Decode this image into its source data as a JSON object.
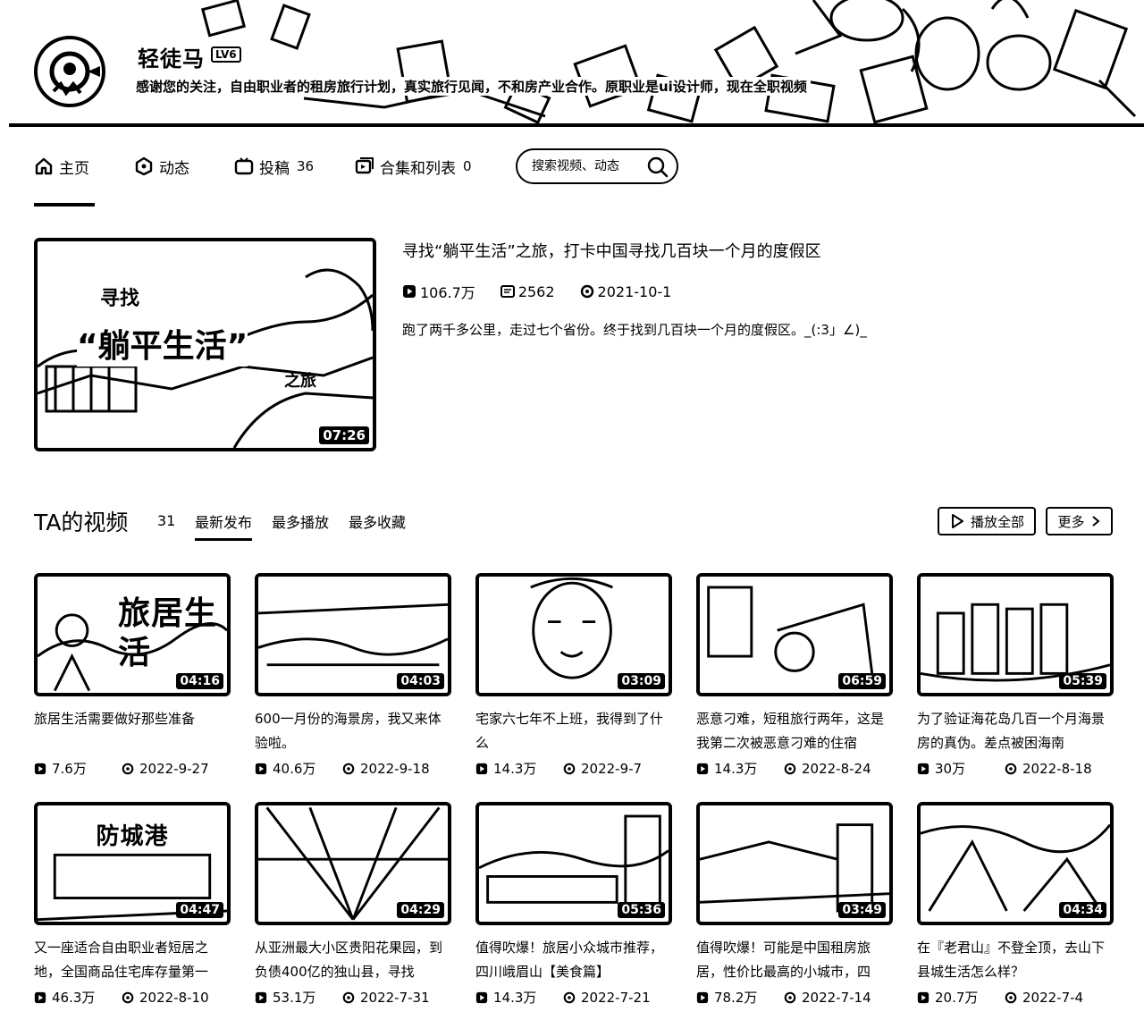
{
  "header": {
    "username": "轻徒马",
    "level": "LV6",
    "sign": "感谢您的关注，自由职业者的租房旅行计划，真实旅行见闻，不和房产业合作。原职业是ui设计师，现在全职视频"
  },
  "nav": {
    "home": "主页",
    "dynamic": "动态",
    "uploads": "投稿",
    "uploads_count": "36",
    "collections": "合集和列表",
    "collections_count": "0",
    "search_placeholder": "搜索视频、动态"
  },
  "featured": {
    "title": "寻找“躺平生活”之旅，打卡中国寻找几百块一个月的度假区",
    "views": "106.7万",
    "danmaku": "2562",
    "date": "2021-10-1",
    "description": "跑了两千多公里，走过七个省份。终于找到几百块一个月的度假区。_(:3」∠)_",
    "duration": "07:26",
    "thumb_text_1": "寻找",
    "thumb_text_2": "“躺平生活”",
    "thumb_text_3": "之旅"
  },
  "videos_section": {
    "title": "TA的视频",
    "count": "31",
    "tabs": [
      "最新发布",
      "最多播放",
      "最多收藏"
    ],
    "play_all": "播放全部",
    "more": "更多"
  },
  "videos": [
    {
      "title": "旅居生活需要做好那些准备",
      "views": "7.6万",
      "date": "2022-9-27",
      "duration": "04:16",
      "thumb_text": "旅居生活"
    },
    {
      "title": "600一月份的海景房，我又来体验啦。",
      "views": "40.6万",
      "date": "2022-9-18",
      "duration": "04:03",
      "thumb_text": ""
    },
    {
      "title": "宅家六七年不上班，我得到了什么",
      "views": "14.3万",
      "date": "2022-9-7",
      "duration": "03:09",
      "thumb_text": ""
    },
    {
      "title": "恶意刁难，短租旅行两年，这是我第二次被恶意刁难的住宿",
      "views": "14.3万",
      "date": "2022-8-24",
      "duration": "06:59",
      "thumb_text": ""
    },
    {
      "title": "为了验证海花岛几百一个月海景房的真伪。差点被困海南",
      "views": "30万",
      "date": "2022-8-18",
      "duration": "05:39",
      "thumb_text": ""
    },
    {
      "title": "又一座适合自由职业者短居之地，全国商品住宅库存量第一",
      "views": "46.3万",
      "date": "2022-8-10",
      "duration": "04:47",
      "thumb_text": "防城港"
    },
    {
      "title": "从亚洲最大小区贵阳花果园，到负债400亿的独山县，寻找",
      "views": "53.1万",
      "date": "2022-7-31",
      "duration": "04:29",
      "thumb_text": ""
    },
    {
      "title": "值得吹爆！旅居小众城市推荐，四川峨眉山【美食篇】",
      "views": "14.3万",
      "date": "2022-7-21",
      "duration": "05:36",
      "thumb_text": ""
    },
    {
      "title": "值得吹爆！可能是中国租房旅居，性价比最高的小城市，四",
      "views": "78.2万",
      "date": "2022-7-14",
      "duration": "03:49",
      "thumb_text": ""
    },
    {
      "title": "在『老君山』不登全顶，去山下县城生活怎么样？",
      "views": "20.7万",
      "date": "2022-7-4",
      "duration": "04:34",
      "thumb_text": ""
    }
  ]
}
